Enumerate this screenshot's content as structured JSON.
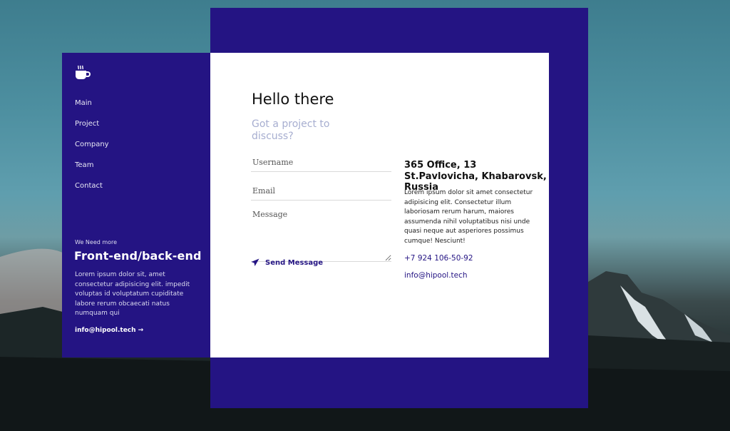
{
  "nav": [
    "Main",
    "Project",
    "Company",
    "Team",
    "Contact"
  ],
  "sidebar": {
    "need_label": "We Need more",
    "need_title": "Front-end/back-end",
    "need_desc": "Lorem ipsum dolor sit, amet consectetur adipisicing elit. impedit voluptas id voluptatum cupiditate labore rerum obcaecati natus numquam qui",
    "email": "info@hipool.tech →"
  },
  "form": {
    "title": "Hello there",
    "subtitle": "Got a project to discuss?",
    "username_placeholder": "Username",
    "email_placeholder": "Email",
    "message_placeholder": "Message",
    "send_label": "Send Message"
  },
  "contact": {
    "address": "365 Office, 13 St.Pavlovicha, Khabarovsk, Russia",
    "description": "Lorem ipsum dolor sit amet consectetur adipisicing elit. Consectetur illum laboriosam rerum harum, maiores assumenda nihil voluptatibus nisi unde quasi neque aut asperiores possimus cumque! Nesciunt!",
    "phone": "+7 924 106-50-92",
    "email": "info@hipool.tech"
  },
  "colors": {
    "brand": "#241483",
    "subtitle": "#a7aed0",
    "card": "#ffffff"
  },
  "icons": {
    "logo": "coffee-cup-icon",
    "send": "paper-plane-icon"
  }
}
